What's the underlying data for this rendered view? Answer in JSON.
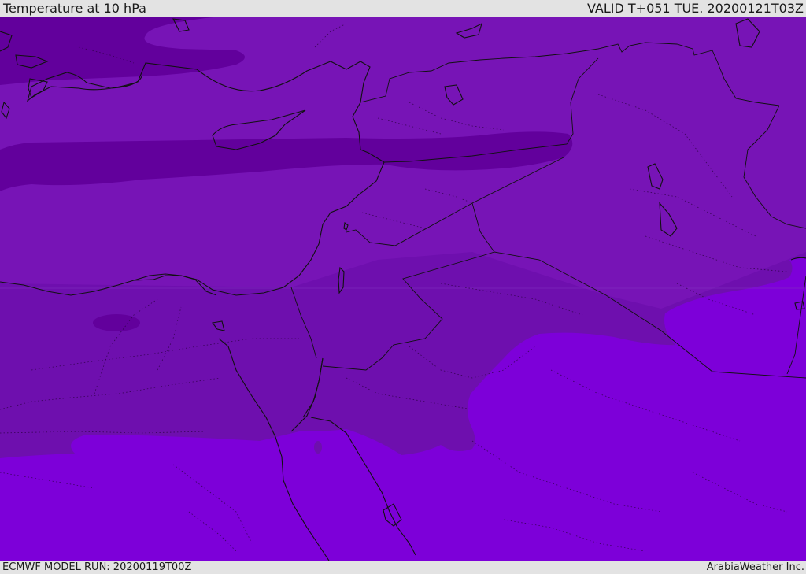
{
  "header": {
    "title": "Temperature at 10 hPa",
    "valid": "VALID T+051 TUE. 20200121T03Z"
  },
  "footer": {
    "model_run": "ECMWF MODEL RUN: 20200119T00Z",
    "credit": "ArabiaWeather Inc."
  },
  "map": {
    "field": "temperature",
    "level": "10 hPa",
    "colors": {
      "band_dark": "#62009c",
      "band_mid": "#7714b6",
      "band_south": "#6e0fae",
      "band_warm": "#7d00d9",
      "coastline": "#111111"
    }
  }
}
